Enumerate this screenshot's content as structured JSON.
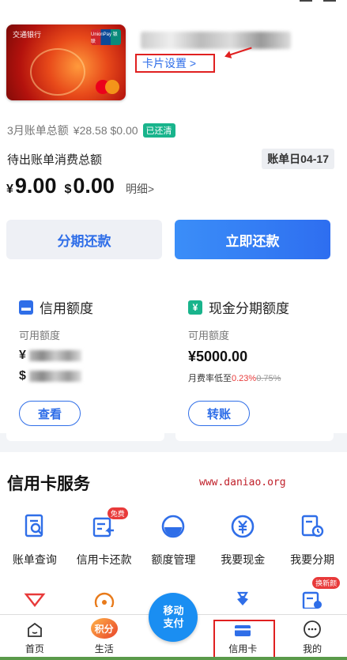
{
  "card": {
    "bank_name": "交通银行",
    "unionpay_label": "UnionPay 银联",
    "master_label": "MasterCard",
    "settings_label": "卡片设置 >"
  },
  "bill": {
    "march_total_label": "3月账单总额",
    "march_amount": "¥28.58 $0.00",
    "paid_badge": "已还清",
    "pending_label": "待出账单消费总额",
    "bill_date": "账单日04-17",
    "rmb_symbol": "¥",
    "rmb_amount": "9.00",
    "usd_symbol": "$",
    "usd_amount": "0.00",
    "detail_link": "明细>"
  },
  "actions": {
    "installment": "分期还款",
    "pay_now": "立即还款"
  },
  "credit_limit": {
    "title": "信用额度",
    "sub": "可用额度",
    "rmb_prefix": "¥",
    "usd_prefix": "$",
    "button": "查看"
  },
  "cash_installment": {
    "title": "现金分期额度",
    "sub": "可用额度",
    "amount": "¥5000.00",
    "rate_prefix": "月费率低至",
    "rate_new": "0.23%",
    "rate_old": "0.75%",
    "button": "转账"
  },
  "services": {
    "title": "信用卡服务",
    "watermark": "www.daniao.org",
    "items": [
      {
        "label": "账单查询",
        "icon": "bill-search-icon"
      },
      {
        "label": "信用卡还款",
        "icon": "card-repay-icon",
        "tag": "免费"
      },
      {
        "label": "额度管理",
        "icon": "limit-manage-icon"
      },
      {
        "label": "我要现金",
        "icon": "cash-icon"
      },
      {
        "label": "我要分期",
        "icon": "installment-icon"
      }
    ],
    "row2_tag": "换新颜"
  },
  "tabbar": {
    "items": [
      {
        "label": "首页"
      },
      {
        "label": "生活",
        "badge": "积分"
      },
      {
        "label": "移动支付"
      },
      {
        "label": "信用卡"
      },
      {
        "label": "我的"
      }
    ]
  },
  "colors": {
    "accent": "#2f6ee8",
    "annotation_red": "#e02020",
    "paid_green": "#19b48c"
  }
}
